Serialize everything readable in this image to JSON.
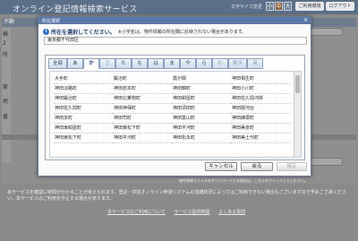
{
  "header": {
    "title": "オンライン登記情報検索サービス",
    "font_size_label": "文字サイズ変更",
    "font_sizes": [
      "小",
      "中",
      "大"
    ],
    "usage_button": "ご利用環境",
    "logout_button": "ログアウト"
  },
  "background": {
    "nav_label": "不動",
    "side_labels": [
      "検",
      "2",
      "所",
      "家",
      "地",
      "番"
    ],
    "footnote": "本サービスを確認に時間がかかることが考えられます。登記・供託オンライン申請システムの混雑状況によってはご利用できない場合もございますので予めご了承ください。本サービスのご利用を中止する場合があります。",
    "notice_text": "物件情報ファイルをダウンロードする場合は、こちらをクリックしてください。",
    "links": [
      "本サービスのご利用について",
      "サービス提供時間",
      "よくある質問"
    ]
  },
  "dialog": {
    "title": "所在選択",
    "close_label": "×",
    "instruction": "所在を選択してください。",
    "instruction_note": "※小字名は、物件情報の所在欄に反映されない場合があります。",
    "address_value": "東京都千代田区",
    "tabs": [
      {
        "label": "全部",
        "state": "normal"
      },
      {
        "label": "あ",
        "state": "normal"
      },
      {
        "label": "か",
        "state": "active"
      },
      {
        "label": "さ",
        "state": "disabled"
      },
      {
        "label": "た",
        "state": "normal"
      },
      {
        "label": "な",
        "state": "normal"
      },
      {
        "label": "は",
        "state": "normal"
      },
      {
        "label": "ま",
        "state": "normal"
      },
      {
        "label": "や",
        "state": "normal"
      },
      {
        "label": "ら",
        "state": "normal"
      },
      {
        "label": "わ",
        "state": "disabled"
      },
      {
        "label": "数字",
        "state": "disabled"
      },
      {
        "label": "英",
        "state": "disabled"
      }
    ],
    "places": [
      "大手町",
      "鍛冶町",
      "霞が関",
      "神田相生町",
      "神田淡路町",
      "神田岩本町",
      "神田錦町",
      "神田小川町",
      "神田鍛冶町",
      "神田北乗物町",
      "神田紺屋町",
      "神田佐久間河岸",
      "神田佐久間町",
      "神田神保町",
      "神田須田町",
      "神田駿河台",
      "神田多町",
      "神田司町",
      "神田富山町",
      "神田練塀町",
      "神田東紺屋町",
      "神田東松下町",
      "神田平河町",
      "神田美倉町",
      "神田東松下町",
      "神田平河町",
      "神田松永町",
      "神田美土代町"
    ],
    "buttons": {
      "cancel": "キャンセル",
      "back": "戻る",
      "confirm": "確定"
    }
  }
}
